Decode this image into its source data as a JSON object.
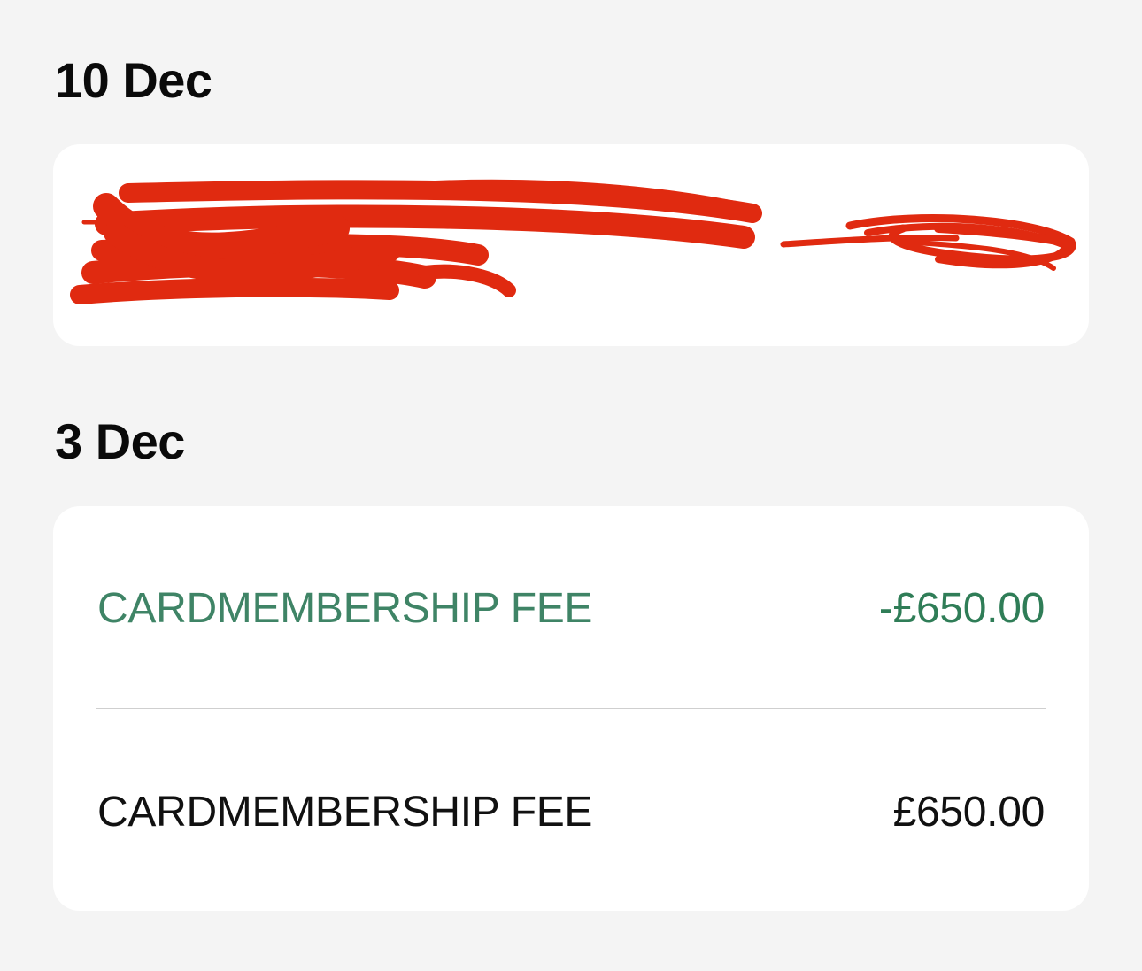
{
  "sections": [
    {
      "date": "10 Dec",
      "redacted": true
    },
    {
      "date": "3 Dec",
      "transactions": [
        {
          "description": "CARDMEMBERSHIP FEE",
          "amount": "-£650.00",
          "tone": "credit",
          "color": "#2f7d57"
        },
        {
          "description": "CARDMEMBERSHIP FEE",
          "amount": "£650.00",
          "tone": "debit",
          "color": "#111111"
        }
      ]
    }
  ],
  "colors": {
    "background": "#f4f4f4",
    "card": "#ffffff",
    "redaction": "#e02a10"
  }
}
